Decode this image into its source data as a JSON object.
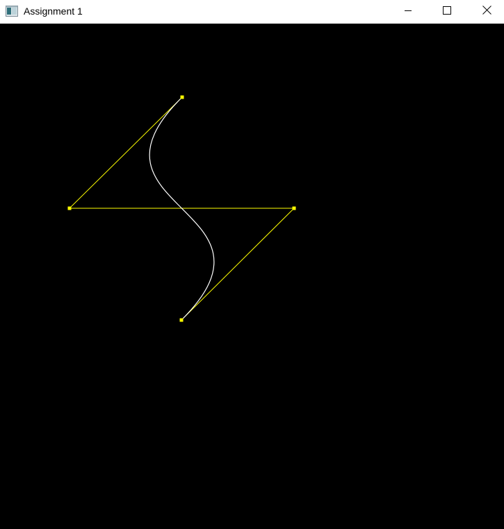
{
  "window": {
    "title": "Assignment 1",
    "icon": "window-app-icon",
    "controls": [
      "minimize-icon",
      "maximize-icon",
      "close-icon"
    ]
  },
  "canvas": {
    "background_color": "#000000",
    "control_polygon_color": "#ffff00",
    "curve_color": "#ffffff"
  }
}
